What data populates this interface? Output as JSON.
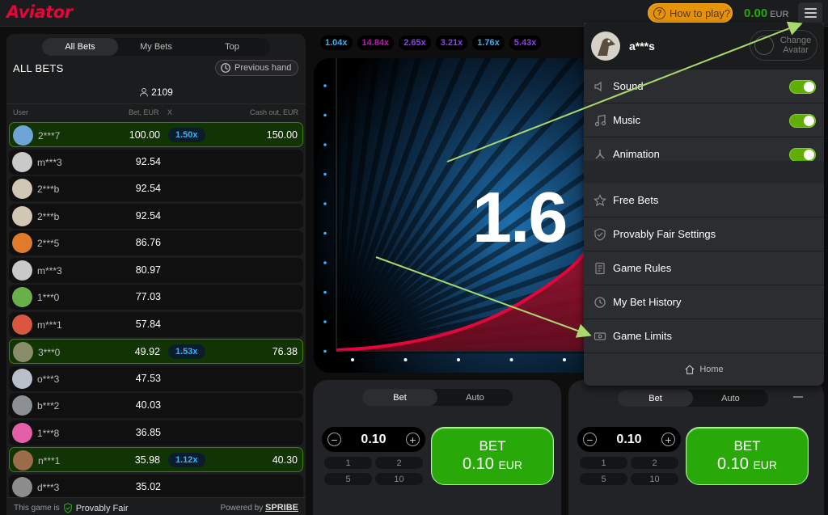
{
  "header": {
    "logo": "Aviator",
    "how_to_play": "How to play?",
    "balance": "0.00",
    "currency": "EUR"
  },
  "bets_panel": {
    "tabs": [
      "All Bets",
      "My Bets",
      "Top"
    ],
    "title": "ALL BETS",
    "previous_hand": "Previous hand",
    "count": "2109",
    "columns": {
      "user": "User",
      "bet": "Bet, EUR",
      "x": "X",
      "cashout": "Cash out, EUR"
    },
    "rows": [
      {
        "user": "2***7",
        "bet": "100.00",
        "mult": "1.50x",
        "cash": "150.00",
        "win": true,
        "color": "#6ea5d6"
      },
      {
        "user": "m***3",
        "bet": "92.54",
        "mult": "",
        "cash": "",
        "win": false,
        "color": "#c9c9c9"
      },
      {
        "user": "2***b",
        "bet": "92.54",
        "mult": "",
        "cash": "",
        "win": false,
        "color": "#d2c7b4"
      },
      {
        "user": "2***b",
        "bet": "92.54",
        "mult": "",
        "cash": "",
        "win": false,
        "color": "#d2c7b4"
      },
      {
        "user": "2***5",
        "bet": "86.76",
        "mult": "",
        "cash": "",
        "win": false,
        "color": "#e07b2c"
      },
      {
        "user": "m***3",
        "bet": "80.97",
        "mult": "",
        "cash": "",
        "win": false,
        "color": "#c9c9c9"
      },
      {
        "user": "1***0",
        "bet": "77.03",
        "mult": "",
        "cash": "",
        "win": false,
        "color": "#68b04a"
      },
      {
        "user": "m***1",
        "bet": "57.84",
        "mult": "",
        "cash": "",
        "win": false,
        "color": "#d9573e"
      },
      {
        "user": "3***0",
        "bet": "49.92",
        "mult": "1.53x",
        "cash": "76.38",
        "win": true,
        "color": "#8a8d6a"
      },
      {
        "user": "o***3",
        "bet": "47.53",
        "mult": "",
        "cash": "",
        "win": false,
        "color": "#b9c0cc"
      },
      {
        "user": "b***2",
        "bet": "40.03",
        "mult": "",
        "cash": "",
        "win": false,
        "color": "#8c8f94"
      },
      {
        "user": "1***8",
        "bet": "36.85",
        "mult": "",
        "cash": "",
        "win": false,
        "color": "#e35fa8"
      },
      {
        "user": "n***1",
        "bet": "35.98",
        "mult": "1.12x",
        "cash": "40.30",
        "win": true,
        "color": "#9c6b4a"
      },
      {
        "user": "d***3",
        "bet": "35.02",
        "mult": "",
        "cash": "",
        "win": false,
        "color": "#8d8d8d"
      }
    ],
    "footer": {
      "this_game_is": "This game is",
      "provably_fair": "Provably Fair",
      "powered_by": "Powered by",
      "brand": "SPRIBE"
    }
  },
  "history": [
    {
      "v": "1.04x",
      "color": "#34b4ff"
    },
    {
      "v": "14.84x",
      "color": "#c017b4"
    },
    {
      "v": "2.65x",
      "color": "#913ef8"
    },
    {
      "v": "3.21x",
      "color": "#913ef8"
    },
    {
      "v": "1.76x",
      "color": "#34b4ff"
    },
    {
      "v": "5.43x",
      "color": "#913ef8"
    }
  ],
  "game": {
    "multiplier": "1.6"
  },
  "bet_panels": [
    {
      "tabs": [
        "Bet",
        "Auto"
      ],
      "amount": "0.10",
      "quick": [
        "1",
        "2",
        "5",
        "10"
      ],
      "button": "BET",
      "btn_amount": "0.10",
      "btn_cur": "EUR"
    },
    {
      "tabs": [
        "Bet",
        "Auto"
      ],
      "amount": "0.10",
      "quick": [
        "1",
        "2",
        "5",
        "10"
      ],
      "button": "BET",
      "btn_amount": "0.10",
      "btn_cur": "EUR"
    }
  ],
  "menu": {
    "username": "a***s",
    "change_avatar": "Change Avatar",
    "toggles": [
      {
        "label": "Sound",
        "on": true
      },
      {
        "label": "Music",
        "on": true
      },
      {
        "label": "Animation",
        "on": true
      }
    ],
    "items": [
      "Free Bets",
      "Provably Fair Settings",
      "Game Rules",
      "My Bet History",
      "Game Limits"
    ],
    "home": "Home"
  }
}
